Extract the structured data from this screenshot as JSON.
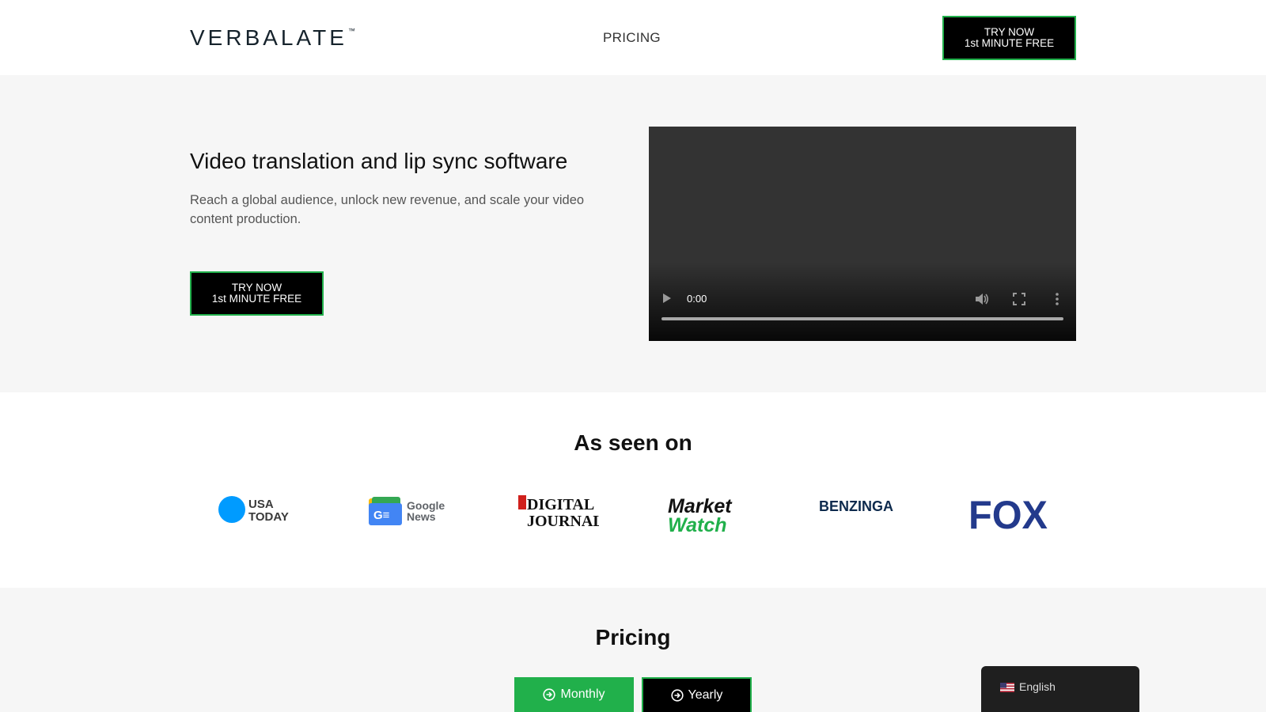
{
  "header": {
    "logo_text": "VERBALATE",
    "logo_tm": "™",
    "nav_pricing": "PRICING",
    "try_line1": "TRY NOW",
    "try_line2": "1st MINUTE FREE"
  },
  "hero": {
    "title": "Video translation and lip sync software",
    "subtitle": "Reach a global audience, unlock new revenue, and scale your video content production.",
    "try_line1": "TRY NOW",
    "try_line2": "1st MINUTE FREE",
    "video": {
      "time": "0:00",
      "icons": [
        "play-icon",
        "volume-icon",
        "fullscreen-icon",
        "more-options-icon"
      ]
    }
  },
  "as_seen_on": {
    "title": "As seen on",
    "logos": [
      {
        "name": "USA TODAY",
        "line1": "USA",
        "line2": "TODAY",
        "color": "#009bff"
      },
      {
        "name": "Google News",
        "line1": "Google",
        "line2": "News"
      },
      {
        "name": "DIGITAL JOURNAL",
        "line1": "DIGITAL",
        "line2": "JOURNAL"
      },
      {
        "name": "MarketWatch",
        "line1": "Market",
        "line2": "Watch",
        "color": "#21b04b"
      },
      {
        "name": "BENZINGA",
        "text": "BENZINGA",
        "color": "#0d2a4d"
      },
      {
        "name": "FOX",
        "text": "FOX",
        "color": "#233a8c"
      }
    ]
  },
  "pricing": {
    "title": "Pricing",
    "tab_monthly": "Monthly",
    "tab_yearly": "Yearly"
  },
  "language": {
    "label": "English"
  },
  "colors": {
    "accent_green": "#21b04b",
    "button_black": "#000000",
    "section_gray": "#f6f6f6"
  }
}
